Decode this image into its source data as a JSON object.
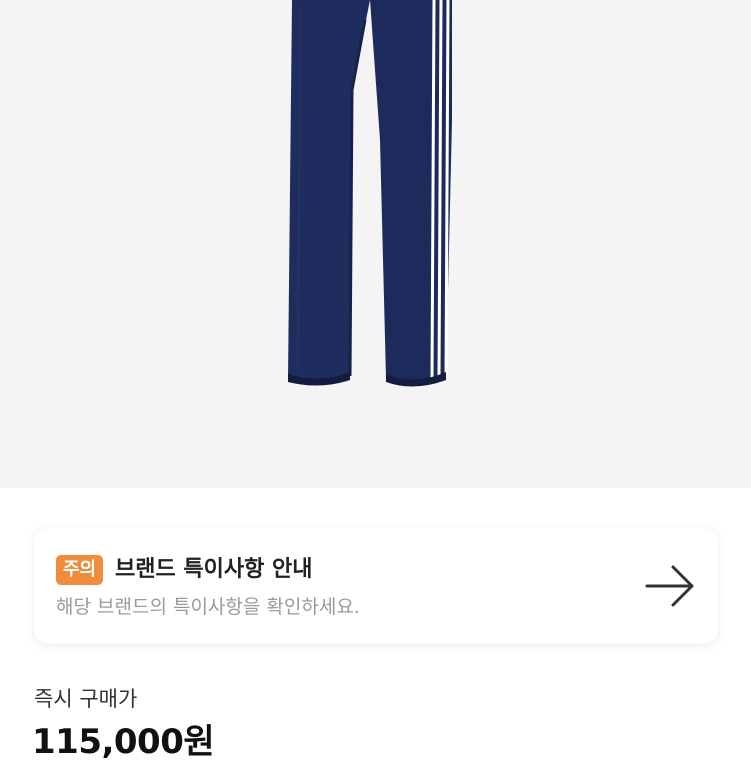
{
  "product": {
    "image_alt": "navy track pants"
  },
  "notice": {
    "badge": "주의",
    "title": "브랜드 특이사항 안내",
    "subtitle": "해당 브랜드의 특이사항을 확인하세요.",
    "action_icon": "arrow-right-icon"
  },
  "pricing": {
    "label": "즉시 구매가",
    "value": "115,000원"
  },
  "colors": {
    "badge": "#f08c3c",
    "pants": "#1f2d5e",
    "hero_background": "#f4f4f4"
  }
}
